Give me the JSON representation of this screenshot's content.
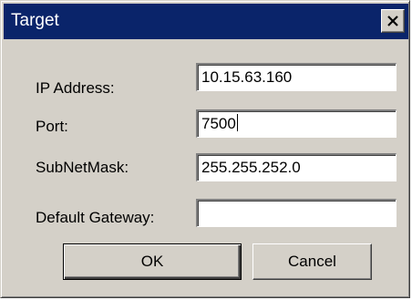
{
  "window": {
    "title": "Target",
    "close_icon": "close-icon"
  },
  "form": {
    "ip_label": "IP Address:",
    "ip_value": "10.15.63.160",
    "port_label": "Port:",
    "port_value": "7500",
    "mask_label": "SubNetMask:",
    "mask_value": "255.255.252.0",
    "gateway_label": "Default Gateway:",
    "gateway_value": ""
  },
  "buttons": {
    "ok_label": "OK",
    "cancel_label": "Cancel"
  },
  "colors": {
    "titlebar": "#0a246a",
    "face": "#d4d0c8"
  }
}
